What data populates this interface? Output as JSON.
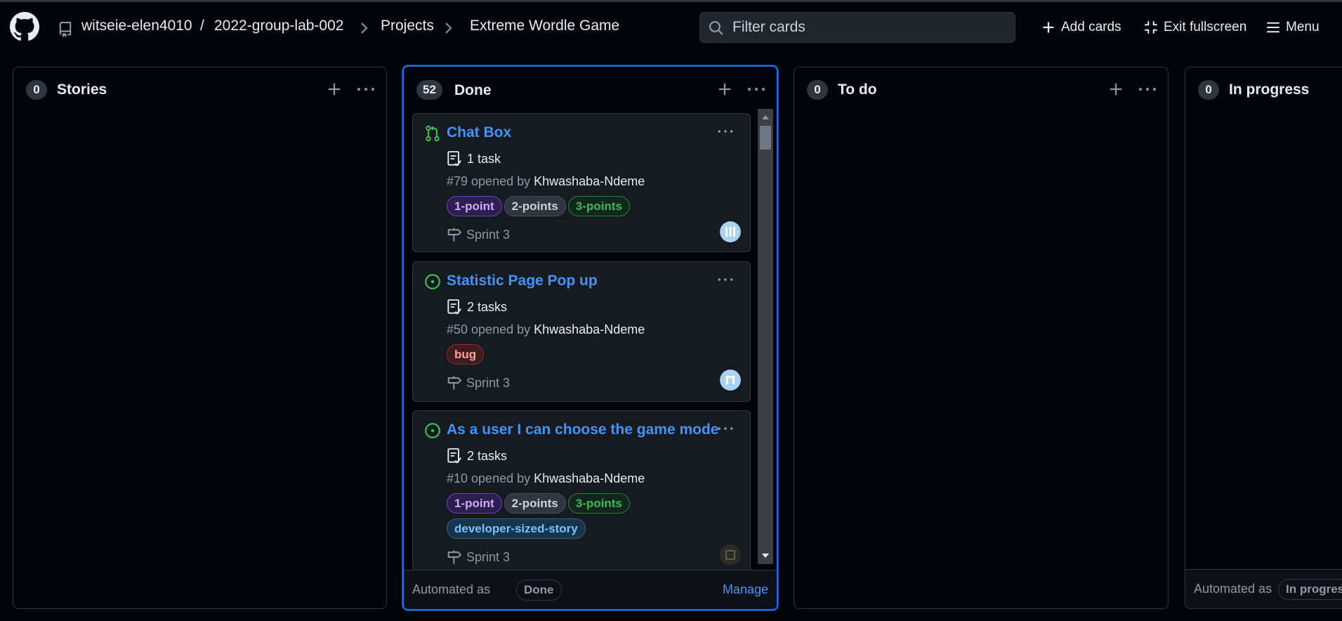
{
  "header": {
    "owner": "witseie-elen4010",
    "separator": "/",
    "repo": "2022-group-lab-002",
    "projects_link": "Projects",
    "project_name": "Extreme Wordle Game",
    "search_placeholder": "Filter cards",
    "add_cards_label": "Add cards",
    "exit_fullscreen_label": "Exit fullscreen",
    "menu_label": "Menu"
  },
  "columns": [
    {
      "title": "Stories",
      "count": "0"
    },
    {
      "title": "Done",
      "count": "52",
      "cards": [
        {
          "state": "pull-request",
          "title": "Chat Box",
          "tasks": "1 task",
          "meta_prefix": "#79 opened by ",
          "author": "Khwashaba-Ndeme",
          "labels": [
            {
              "name": "1-point",
              "color": "#a371f7"
            },
            {
              "name": "2-points",
              "color": "#9198a1"
            },
            {
              "name": "3-points",
              "color": "#3fb950"
            }
          ],
          "milestone": "Sprint 3"
        },
        {
          "state": "open-issue",
          "title": "Statistic Page Pop up",
          "tasks": "2 tasks",
          "meta_prefix": "#50 opened by ",
          "author": "Khwashaba-Ndeme",
          "labels": [
            {
              "name": "bug",
              "color": "#f85149"
            }
          ],
          "milestone": "Sprint 3"
        },
        {
          "state": "open-issue",
          "title": "As a user I can choose the game mode",
          "tasks": "2 tasks",
          "meta_prefix": "#10 opened by ",
          "author": "Khwashaba-Ndeme",
          "labels": [
            {
              "name": "1-point",
              "color": "#a371f7"
            },
            {
              "name": "2-points",
              "color": "#9198a1"
            },
            {
              "name": "3-points",
              "color": "#3fb950"
            },
            {
              "name": "developer-sized-story",
              "color": "#79c0ff"
            }
          ],
          "milestone": "Sprint 3"
        }
      ],
      "footer": {
        "automated_label": "Automated as",
        "automated_value": "Done",
        "manage_label": "Manage"
      }
    },
    {
      "title": "To do",
      "count": "0"
    },
    {
      "title": "In progress",
      "count": "0",
      "footer": {
        "automated_label": "Automated as",
        "automated_value": "In progress"
      }
    }
  ],
  "colors": {
    "accent_blue": "#4493f8",
    "active_border": "#1f6feb",
    "open_issue_green": "#3fb950"
  }
}
